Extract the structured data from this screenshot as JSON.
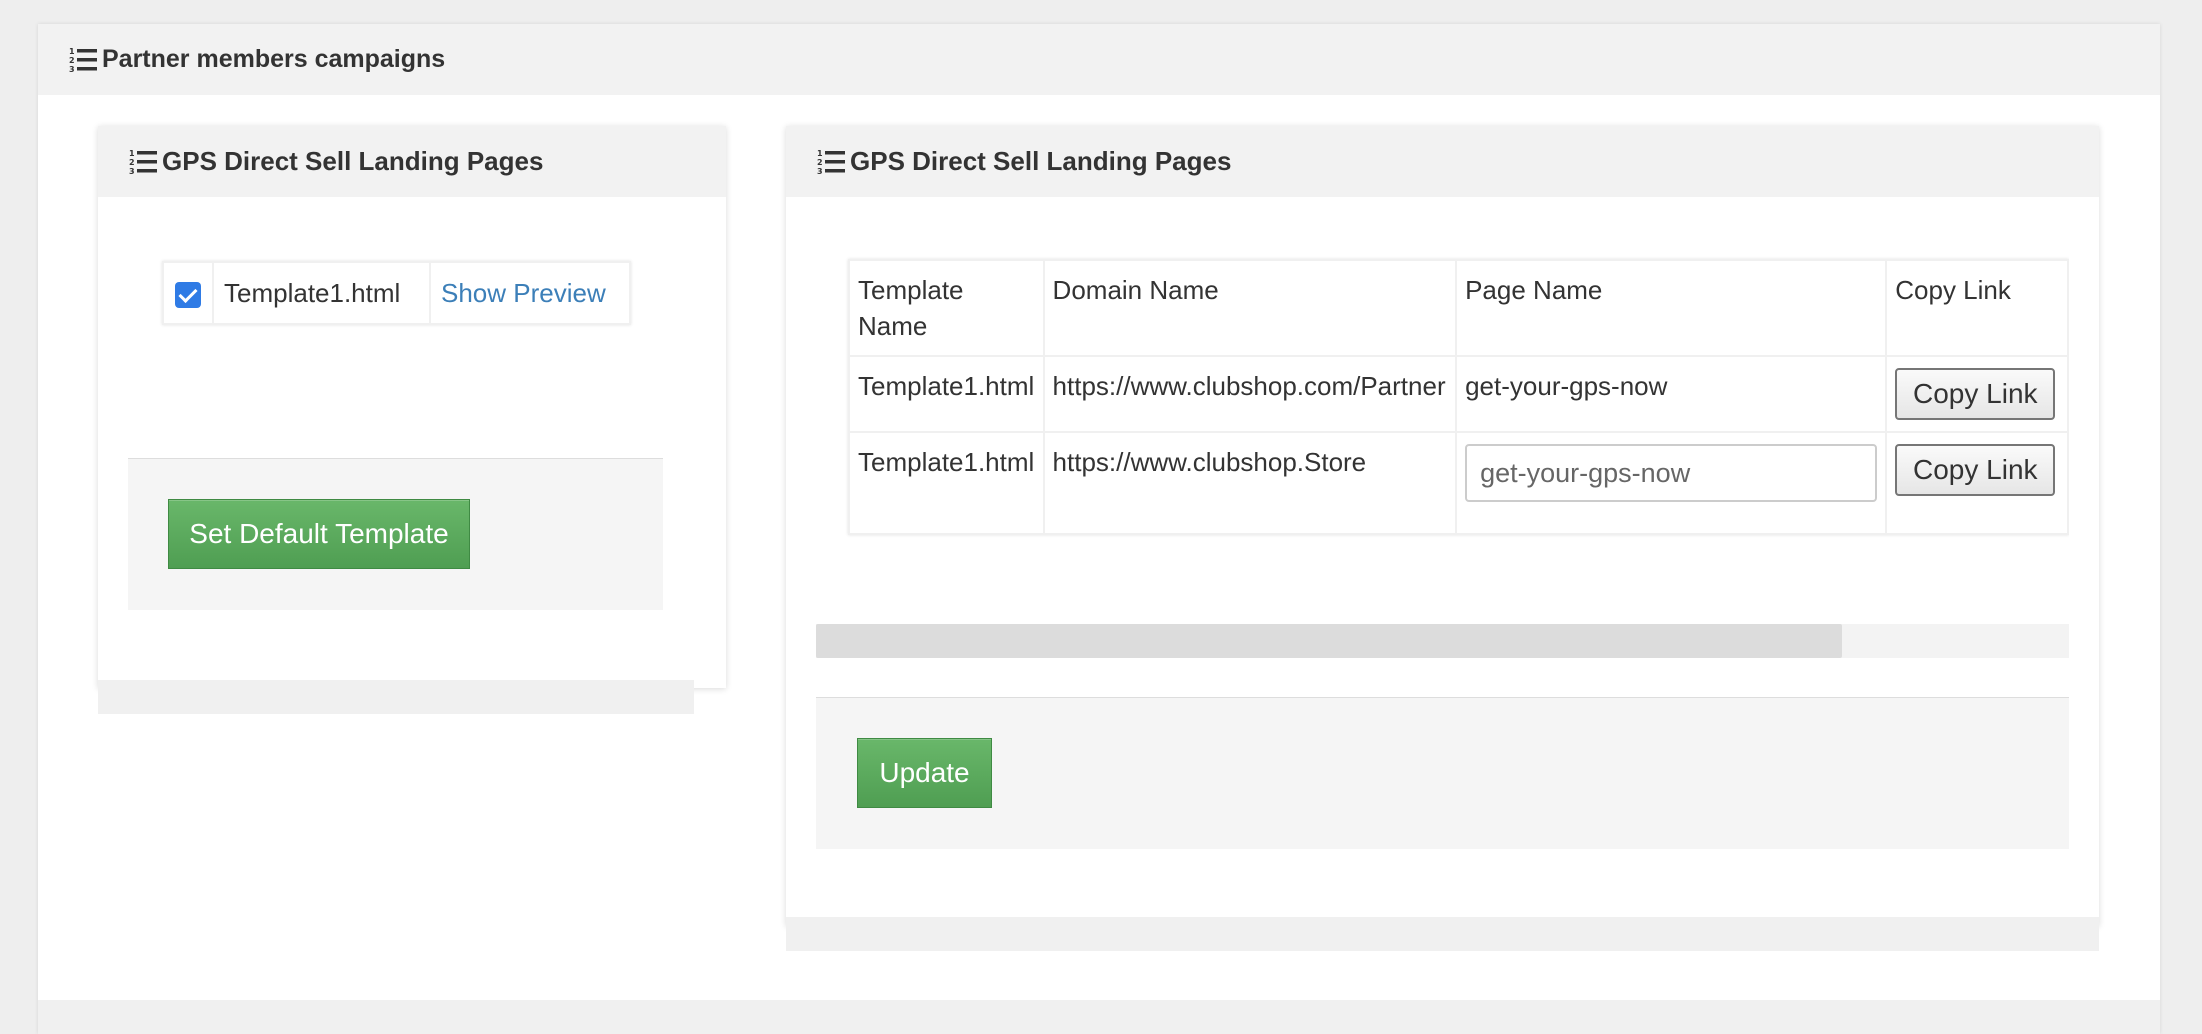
{
  "outer": {
    "title": "Partner members campaigns"
  },
  "left_panel": {
    "title": "GPS Direct Sell Landing Pages",
    "template": {
      "checked": true,
      "name": "Template1.html",
      "preview_link": "Show Preview"
    },
    "default_button": "Set Default Template"
  },
  "right_panel": {
    "title": "GPS Direct Sell Landing Pages",
    "columns": [
      "Template Name",
      "Domain Name",
      "Page Name",
      "Copy Link"
    ],
    "rows": [
      {
        "template": "Template1.html",
        "domain": "https://www.clubshop.com/Partner",
        "page": "get-your-gps-now",
        "copy": "Copy Link"
      },
      {
        "template": "Template1.html",
        "domain": "https://www.clubshop.Store",
        "page_input": "get-your-gps-now",
        "copy": "Copy Link"
      }
    ],
    "update_button": "Update"
  },
  "colors": {
    "accent_green": "#5cb85c",
    "link_blue": "#3c7fb8",
    "checkbox_blue": "#2f7be5"
  },
  "icons": {
    "header": "ordered-list-icon"
  }
}
